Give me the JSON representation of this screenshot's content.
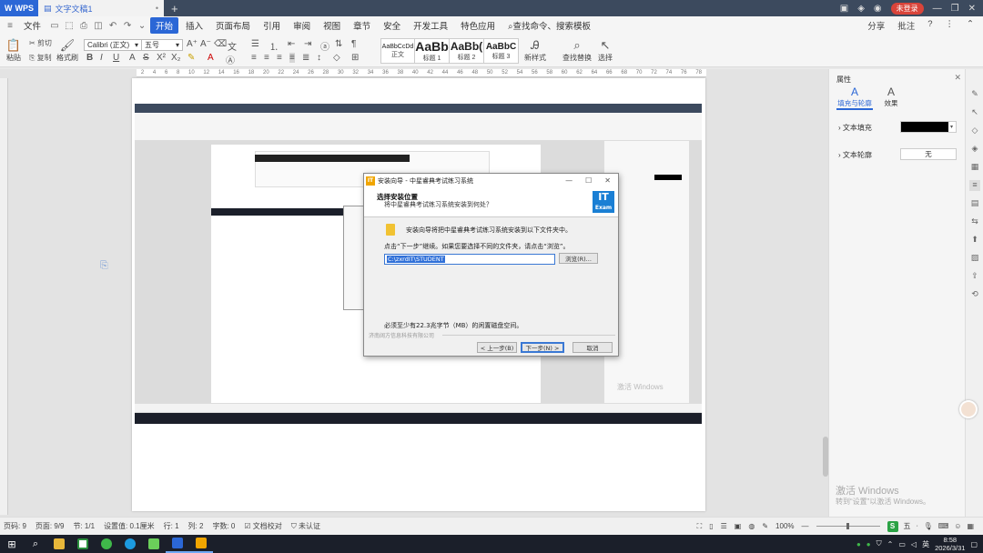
{
  "titlebar": {
    "app_name": "WPS",
    "doc_tab": "文字文稿1",
    "login_badge": "未登录"
  },
  "menubar": {
    "file": "文件",
    "tabs": [
      "开始",
      "插入",
      "页面布局",
      "引用",
      "审阅",
      "视图",
      "章节",
      "安全",
      "开发工具",
      "特色应用"
    ],
    "search": "查找命令、搜索模板",
    "share": "分享",
    "comment": "批注"
  },
  "ribbon": {
    "paste": "粘贴",
    "cut": "剪切",
    "copy": "复制",
    "format_painter": "格式刷",
    "font_name": "Calibri (正文)",
    "font_size": "五号",
    "styles": [
      {
        "sample": "AaBbCcDd",
        "label": "正文"
      },
      {
        "sample": "AaBb",
        "label": "标题 1"
      },
      {
        "sample": "AaBb(",
        "label": "标题 2"
      },
      {
        "sample": "AaBbC",
        "label": "标题 3"
      }
    ],
    "new_style": "新样式",
    "find_replace": "查找替换",
    "select": "选择"
  },
  "ruler_ticks": [
    "2",
    "4",
    "6",
    "8",
    "10",
    "12",
    "14",
    "16",
    "18",
    "20",
    "22",
    "24",
    "26",
    "28",
    "30",
    "32",
    "34",
    "36",
    "38",
    "40",
    "42",
    "44",
    "46",
    "48",
    "50",
    "52",
    "54",
    "56",
    "58",
    "60",
    "62",
    "64",
    "66",
    "68",
    "70",
    "72",
    "74",
    "76",
    "78"
  ],
  "dialog": {
    "title": "安装向导 - 中星睿典考试练习系统",
    "heading": "选择安装位置",
    "subheading": "将中星睿典考试练习系统安装到何处？",
    "logo_top": "IT",
    "logo_bottom": "Exam",
    "info": "安装向导将把中星睿典考试练习系统安装到以下文件夹中。",
    "instruction": "点击“下一步”继续。如果您要选择不同的文件夹，请点击“浏览”。",
    "path": "C:\\zxrdIT\\STUDENT",
    "browse": "浏览(R)...",
    "disk_space": "必须至少有22.3兆字节（MB）的闲置磁盘空间。",
    "company": "济南阔方信息科技有限公司",
    "back": "< 上一步(B)",
    "next": "下一步(N) >",
    "cancel": "取消"
  },
  "inner_watermark": "激活 Windows",
  "right_pane": {
    "title": "属性",
    "tab_fill": "填充与轮廓",
    "tab_effect": "效果",
    "text_fill": "文本填充",
    "text_outline": "文本轮廓",
    "outline_value": "无"
  },
  "watermark": {
    "line1": "激活 Windows",
    "line2": "转到“设置”以激活 Windows。"
  },
  "statusbar": {
    "page": "页码: 9",
    "pages": "页面: 9/9",
    "section": "节: 1/1",
    "setting": "设置值: 0.1厘米",
    "row": "行: 1",
    "col": "列: 2",
    "words": "字数: 0",
    "proofread": "文档校对",
    "auth": "未认证",
    "zoom": "100%",
    "ime_char": "五"
  },
  "taskbar": {
    "time": "8:58",
    "date": "2026/3/31"
  },
  "colors": {
    "accent": "#2b67d6",
    "titlebar": "#3c4a5e",
    "taskbar": "#1b1f2a",
    "login_badge": "#d9443a",
    "it_logo": "#1a7fd4",
    "installer_icon": "#f0a500"
  }
}
